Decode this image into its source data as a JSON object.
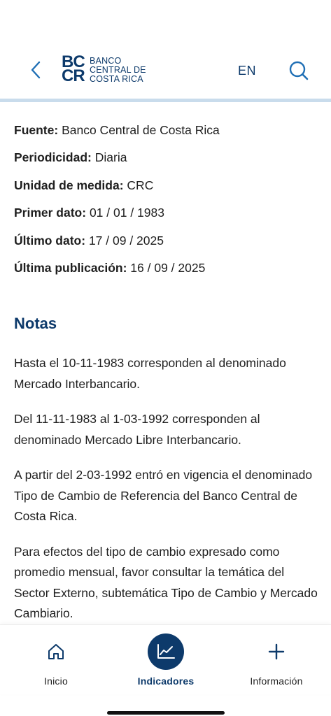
{
  "header": {
    "logo_mark_top": "BC",
    "logo_mark_bottom": "CR",
    "logo_line1": "BANCO",
    "logo_line2": "CENTRAL DE",
    "logo_line3": "COSTA RICA",
    "language": "EN",
    "icons": {
      "back": "chevron-left-icon",
      "search": "search-icon"
    }
  },
  "metadata": [
    {
      "label": "Fuente:",
      "value": "Banco Central de Costa Rica"
    },
    {
      "label": "Periodicidad:",
      "value": "Diaria"
    },
    {
      "label": "Unidad de medida:",
      "value": "CRC"
    },
    {
      "label": "Primer dato:",
      "value": "01 / 01 / 1983"
    },
    {
      "label": "Último dato:",
      "value": "17 / 09 / 2025"
    },
    {
      "label": "Última publicación:",
      "value": "16 / 09 / 2025"
    }
  ],
  "notes": {
    "title": "Notas",
    "paragraphs": [
      "Hasta el 10-11-1983 corresponden al denominado Mercado Interbancario.",
      "Del 11-11-1983 al 1-03-1992 corresponden al denominado Mercado Libre Interbancario.",
      "A partir del 2-03-1992 entró en vigencia el denominado Tipo de Cambio de Referencia del Banco Central de Costa Rica.",
      "Para efectos del tipo de cambio expresado como promedio mensual, favor consultar la temática del Sector Externo, subtemática Tipo de Cambio y Mercado Cambiario."
    ]
  },
  "bottom_nav": {
    "items": [
      {
        "label": "Inicio",
        "icon": "home-icon",
        "active": false
      },
      {
        "label": "Indicadores",
        "icon": "chart-line-icon",
        "active": true
      },
      {
        "label": "Información",
        "icon": "plus-icon",
        "active": false
      }
    ]
  },
  "colors": {
    "brand": "#0d3a6b",
    "header_rule": "#c9dcec",
    "text": "#1f1f1f"
  }
}
